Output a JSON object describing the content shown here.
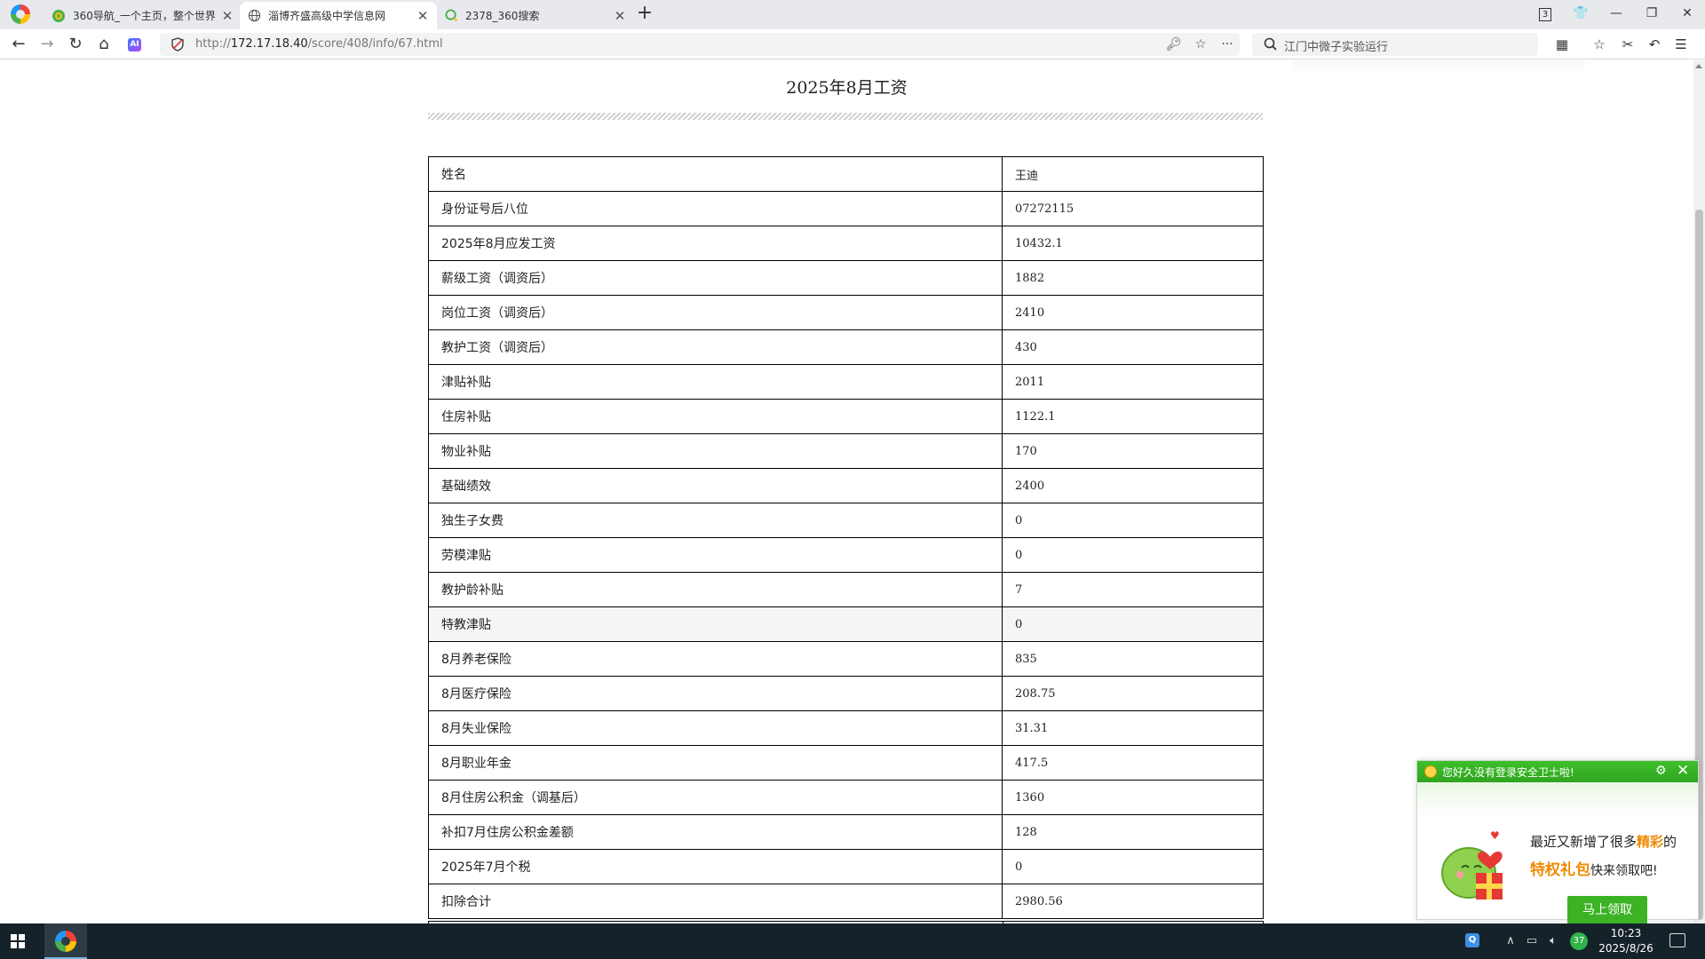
{
  "browser": {
    "tabs": [
      {
        "label": "360导航_一个主页，整个世界",
        "active": false
      },
      {
        "label": "淄博齐盛高级中学信息网",
        "active": true
      },
      {
        "label": "2378_360搜索",
        "active": false
      }
    ],
    "tab_count": "3",
    "url_prefix": "http://",
    "url_host": "172.17.18.40",
    "url_path": "/score/408/info/67.html",
    "search_text": "江门中微子实验运行"
  },
  "page": {
    "title": "2025年8月工资",
    "rows": [
      {
        "label": "姓名",
        "value": "王迪"
      },
      {
        "label": "身份证号后八位",
        "value": "07272115"
      },
      {
        "label": "2025年8月应发工资",
        "value": "10432.1"
      },
      {
        "label": "薪级工资（调资后）",
        "value": "1882"
      },
      {
        "label": "岗位工资（调资后）",
        "value": "2410"
      },
      {
        "label": "教护工资（调资后）",
        "value": "430"
      },
      {
        "label": "津贴补贴",
        "value": "2011"
      },
      {
        "label": "住房补贴",
        "value": "1122.1"
      },
      {
        "label": "物业补贴",
        "value": "170"
      },
      {
        "label": "基础绩效",
        "value": "2400"
      },
      {
        "label": "独生子女费",
        "value": "0"
      },
      {
        "label": "劳模津贴",
        "value": "0"
      },
      {
        "label": "教护龄补贴",
        "value": "7"
      },
      {
        "label": "特教津贴",
        "value": "0"
      },
      {
        "label": "8月养老保险",
        "value": "835"
      },
      {
        "label": "8月医疗保险",
        "value": "208.75"
      },
      {
        "label": "8月失业保险",
        "value": "31.31"
      },
      {
        "label": "8月职业年金",
        "value": "417.5"
      },
      {
        "label": "8月住房公积金（调基后）",
        "value": "1360"
      },
      {
        "label": "补扣7月住房公积金差额",
        "value": "128"
      },
      {
        "label": "2025年7月个税",
        "value": "0"
      },
      {
        "label": "扣除合计",
        "value": "2980.56"
      }
    ]
  },
  "popup": {
    "title": "您好久没有登录安全卫士啦!",
    "line1_a": "最近又新增了很多",
    "line1_accent": "精彩",
    "line1_b": "的",
    "line2_accent": "特权礼包",
    "line2_b": "快来领取吧!",
    "button": "马上领取"
  },
  "taskbar": {
    "time": "10:23",
    "date": "2025/8/26",
    "tray_badge": "37"
  },
  "colors": {
    "popup_green": "#3bb324",
    "accent_orange": "#f08a00",
    "taskbar_bg": "#16222a"
  }
}
